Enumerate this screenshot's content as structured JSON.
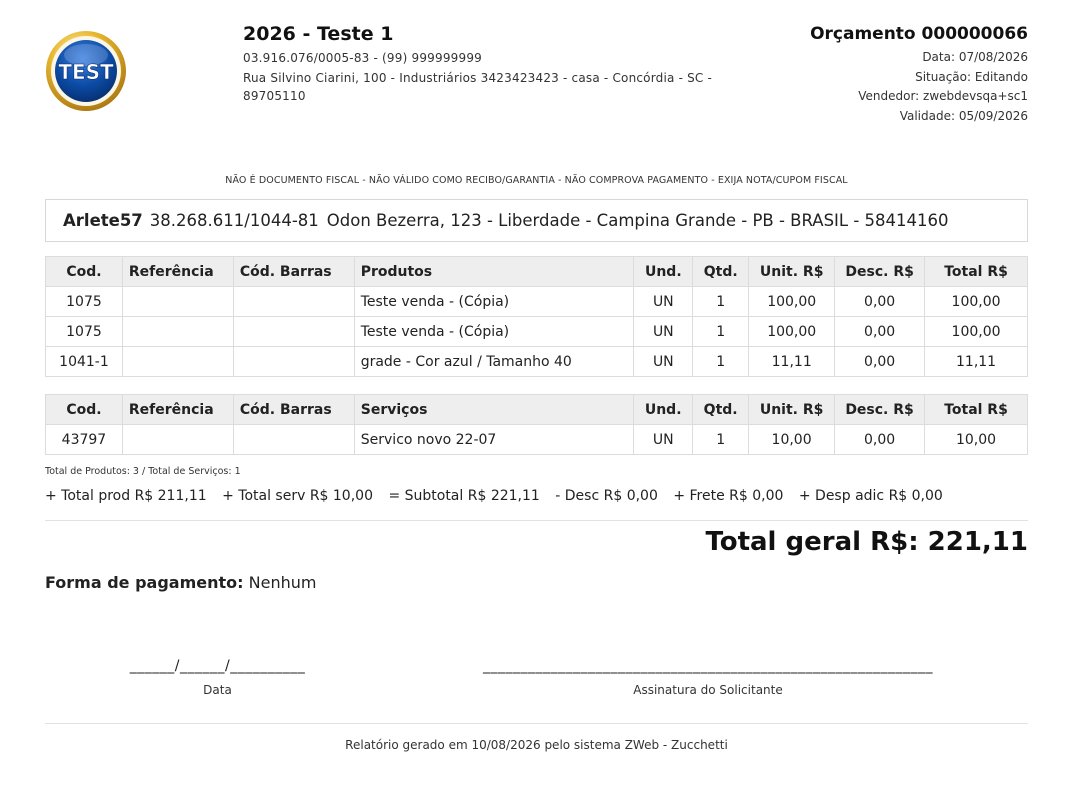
{
  "company": {
    "logo_text": "TEST",
    "name": "2026 - Teste 1",
    "doc_phone": "03.916.076/0005-83 - (99) 999999999",
    "address_line1": "Rua Silvino Ciarini, 100 - Industriários 3423423423 - casa - Concórdia - SC -",
    "address_line2": "89705110"
  },
  "quote": {
    "title": "Orçamento 000000066",
    "date": "Data: 07/08/2026",
    "status": "Situação: Editando",
    "seller": "Vendedor: zwebdevsqa+sc1",
    "validity": "Validade: 05/09/2026"
  },
  "disclaimer": "NÃO É DOCUMENTO FISCAL - NÃO VÁLIDO COMO RECIBO/GARANTIA - NÃO COMPROVA PAGAMENTO - EXIJA NOTA/CUPOM FISCAL",
  "client": {
    "name": "Arlete57",
    "document": "38.268.611/1044-81",
    "address": "Odon Bezerra, 123 - Liberdade - Campina Grande - PB - BRASIL - 58414160"
  },
  "products": {
    "headers": [
      "Cod.",
      "Referência",
      "Cód. Barras",
      "Produtos",
      "Und.",
      "Qtd.",
      "Unit. R$",
      "Desc. R$",
      "Total R$"
    ],
    "rows": [
      [
        "1075",
        "",
        "",
        "Teste venda - (Cópia)",
        "UN",
        "1",
        "100,00",
        "0,00",
        "100,00"
      ],
      [
        "1075",
        "",
        "",
        "Teste venda - (Cópia)",
        "UN",
        "1",
        "100,00",
        "0,00",
        "100,00"
      ],
      [
        "1041-1",
        "",
        "",
        "grade - Cor azul / Tamanho 40",
        "UN",
        "1",
        "11,11",
        "0,00",
        "11,11"
      ]
    ]
  },
  "services": {
    "headers": [
      "Cod.",
      "Referência",
      "Cód. Barras",
      "Serviços",
      "Und.",
      "Qtd.",
      "Unit. R$",
      "Desc. R$",
      "Total R$"
    ],
    "rows": [
      [
        "43797",
        "",
        "",
        "Servico novo 22-07",
        "UN",
        "1",
        "10,00",
        "0,00",
        "10,00"
      ]
    ]
  },
  "summary": {
    "counts": "Total de Produtos: 3 / Total de Serviços: 1",
    "total_prod": "+ Total prod R$ 211,11",
    "total_serv": "+ Total serv R$ 10,00",
    "subtotal": "= Subtotal R$ 221,11",
    "desc": "- Desc R$ 0,00",
    "frete": "+ Frete R$ 0,00",
    "desp": "+ Desp adic R$ 0,00",
    "grand_total": "Total geral R$: 221,11"
  },
  "payment": {
    "label": "Forma de pagamento:",
    "value": "Nenhum"
  },
  "signatures": {
    "date_line": "______/______/__________",
    "date_label": "Data",
    "sign_line": "____________________________________________________________",
    "sign_label": "Assinatura do Solicitante"
  },
  "footer": "Relatório gerado em 10/08/2026 pelo sistema ZWeb - Zucchetti",
  "colors": {
    "logo_blue": "#0b4aa3",
    "logo_gold": "#d9a423",
    "header_bg": "#eeeeee"
  }
}
